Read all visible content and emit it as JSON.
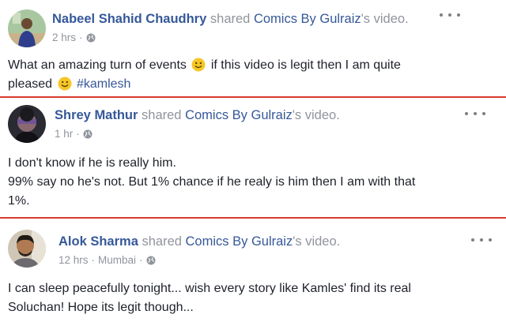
{
  "posts": [
    {
      "author": "Nabeel Shahid Chaudhry",
      "action": "shared",
      "page": "Comics By Gulraiz",
      "page_suffix": "'s video.",
      "time": "2 hrs",
      "privacy_icon": "globe-icon",
      "text_line1_a": "What an amazing turn of events",
      "text_line1_b": "if this video is legit then I am quite",
      "text_line2_a": "pleased",
      "hashtag": "#kamlesh"
    },
    {
      "author": "Shrey Mathur",
      "action": "shared",
      "page": "Comics By Gulraiz",
      "page_suffix": "'s video.",
      "time": "1 hr",
      "privacy_icon": "globe-icon",
      "text_line1": "I don't know if he is really him.",
      "text_line2": "99% say no he's not. But 1% chance if he realy is him then I am with that",
      "text_line3": "1%."
    },
    {
      "author": "Alok Sharma",
      "action": "shared",
      "page": "Comics By Gulraiz",
      "page_suffix": "'s video.",
      "time": "12 hrs",
      "location": "Mumbai",
      "privacy_icon": "globe-icon",
      "text_line1": "I can sleep peacefully tonight... wish every story like Kamles' find its real",
      "text_line2": "Soluchan! Hope its legit though..."
    }
  ],
  "colors": {
    "link": "#365899",
    "meta": "#90949c",
    "text": "#1d2129",
    "divider": "#d93a30",
    "smiley": "#f7c628"
  }
}
